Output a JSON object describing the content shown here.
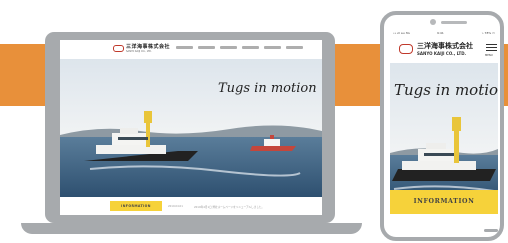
{
  "colors": {
    "accent_orange": "#e8903a",
    "device_gray": "#a7aaad",
    "info_yellow": "#f6d23a",
    "sky": "#e9eef2",
    "sea": "#3d6384",
    "tug_red": "#c4463b",
    "tug_mast_yellow": "#e9c53a"
  },
  "laptop": {
    "company_name_jp": "三洋海事株式会社",
    "company_name_en": "SANYO KAIJI CO., LTD.",
    "tagline": "Tugs in motion",
    "info_button": "INFORMATION",
    "news_date": "2019.04.01",
    "news_text": "2019年4月1日 弊社ホームページをリニューアルしました。"
  },
  "phone": {
    "status_left": "•••ll au 3G",
    "status_time": "9:41",
    "status_right": "⌁ 78% ▭",
    "company_name_jp": "三洋海事株式会社",
    "company_name_en": "SANYO KAIJI CO., LTD.",
    "menu_label": "MENU",
    "tagline": "Tugs in motion",
    "info_button": "INFORMATION"
  }
}
